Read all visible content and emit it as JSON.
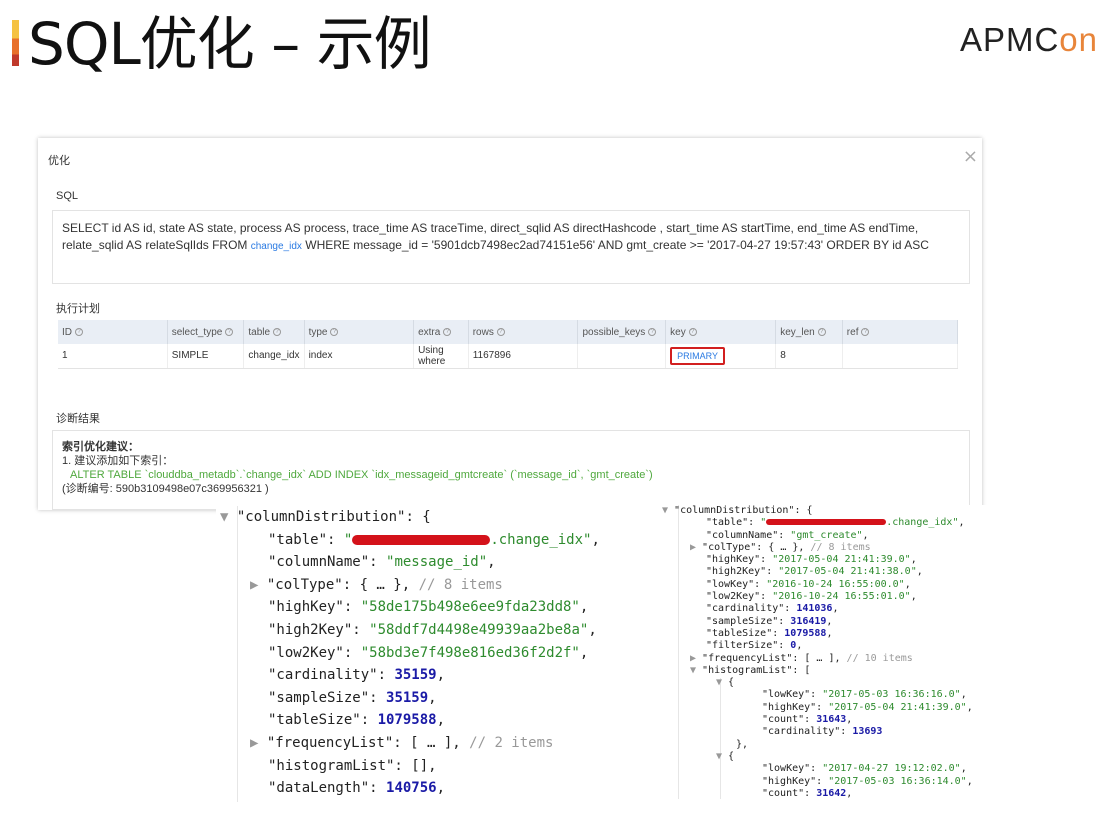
{
  "slide": {
    "title": "SQL优化 – 示例",
    "logo_main": "APMC",
    "logo_accent": "on"
  },
  "panel": {
    "title": "优化",
    "close_label": "×",
    "sql_label": "SQL",
    "sql_text_1": "SELECT id AS id, state AS state, process AS process, trace_time AS traceTime, direct_sqlid AS directHashcode , start_time AS startTime, end_time AS endTime,",
    "sql_text_2_pre": "relate_sqlid AS relateSqlIds FROM ",
    "sql_table": "change_idx",
    "sql_text_2_post": " WHERE message_id = '5901dcb7498ec2ad74151e56' AND gmt_create >= '2017-04-27 19:57:43' ORDER BY id ASC",
    "plan_label": "执行计划",
    "plan_headers": [
      "ID",
      "select_type",
      "table",
      "type",
      "extra",
      "rows",
      "possible_keys",
      "key",
      "key_len",
      "ref"
    ],
    "plan_row": [
      "1",
      "SIMPLE",
      "change_idx",
      "index",
      "Using where",
      "1167896",
      "",
      "PRIMARY",
      "8",
      ""
    ],
    "diag_label": "诊断结果",
    "diag_heading": "索引优化建议：",
    "diag_line1": "1. 建议添加如下索引：",
    "diag_sql": "ALTER TABLE `clouddba_metadb`.`change_idx` ADD INDEX `idx_messageid_gmtcreate` (`message_id`, `gmt_create`)",
    "diag_line3": "(诊断编号: 590b3109498e07c369956321 )"
  },
  "json_left": {
    "root_key": "\"columnDistribution\"",
    "table_key": "\"table\"",
    "table_val": ".change_idx\"",
    "columnName_val": "\"message_id\"",
    "colType_comment": "// 8 items",
    "highKey_val": "\"58de175b498e6ee9fda23dd8\"",
    "high2Key_val": "\"58ddf7d4498e49939aa2be8a\"",
    "low2Key_val": "\"58bd3e7f498e816ed36f2d2f\"",
    "cardinality": "35159",
    "sampleSize": "35159",
    "tableSize": "1079588",
    "frequency_comment": "// 2 items",
    "dataLength": "140756"
  },
  "json_right": {
    "table_val": ".change_idx\"",
    "columnName_val": "\"gmt_create\"",
    "colType_comment": "// 8 items",
    "highKey_val": "\"2017-05-04 21:41:39.0\"",
    "high2Key_val": "\"2017-05-04 21:41:38.0\"",
    "lowKey_val": "\"2016-10-24 16:55:00.0\"",
    "low2Key_val": "\"2016-10-24 16:55:01.0\"",
    "cardinality": "141036",
    "sampleSize": "316419",
    "tableSize": "1079588",
    "filterSize": "0",
    "frequency_comment": "// 10 items",
    "h1_lowKey": "\"2017-05-03 16:36:16.0\"",
    "h1_highKey": "\"2017-05-04 21:41:39.0\"",
    "h1_count": "31643",
    "h1_cardinality": "13693",
    "h2_lowKey": "\"2017-04-27 19:12:02.0\"",
    "h2_highKey": "\"2017-05-03 16:36:14.0\"",
    "h2_count": "31642"
  },
  "colors": {
    "highlight_border": "#d21f1f",
    "link": "#2a7ae2",
    "json_string": "#2e8b2e",
    "json_number": "#1a1aa6",
    "logo_accent": "#e8853a"
  }
}
